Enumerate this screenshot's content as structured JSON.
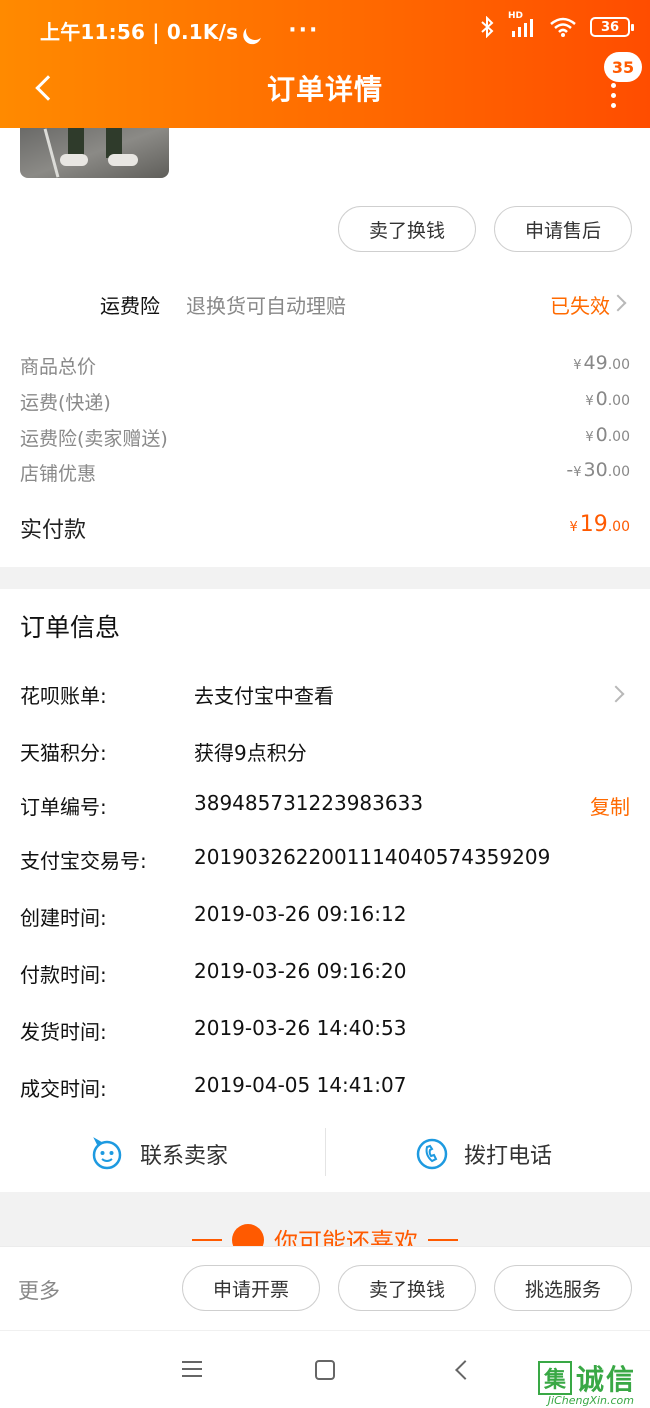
{
  "status_bar": {
    "time_speed": "上午11:56 | 0.1K/s",
    "more_dots": "···",
    "network": "HD",
    "battery": "36"
  },
  "nav": {
    "title": "订单详情",
    "badge_count": "35"
  },
  "order_actions": {
    "sell_exchange": "卖了换钱",
    "after_sale": "申请售后"
  },
  "insurance": {
    "label": "运费险",
    "description": "退换货可自动理赔",
    "status": "已失效"
  },
  "prices": [
    {
      "label": "商品总价",
      "currency": "¥",
      "integer": "49",
      "decimal": ".00",
      "prefix": ""
    },
    {
      "label": "运费(快递)",
      "currency": "¥",
      "integer": "0",
      "decimal": ".00",
      "prefix": ""
    },
    {
      "label": "运费险(卖家赠送)",
      "currency": "¥",
      "integer": "0",
      "decimal": ".00",
      "prefix": ""
    },
    {
      "label": "店铺优惠",
      "currency": "¥",
      "integer": "30",
      "decimal": ".00",
      "prefix": "-"
    }
  ],
  "total": {
    "label": "实付款",
    "currency": "¥",
    "integer": "19",
    "decimal": ".00"
  },
  "order_info": {
    "title": "订单信息",
    "rows": [
      {
        "label": "花呗账单:",
        "value": "去支付宝中查看"
      },
      {
        "label": "天猫积分:",
        "value": "获得9点积分"
      },
      {
        "label": "订单编号:",
        "value": "389485731223983633",
        "action": "复制"
      },
      {
        "label": "支付宝交易号:",
        "value": "2019032622001114040574359209"
      },
      {
        "label": "创建时间:",
        "value": "2019-03-26 09:16:12"
      },
      {
        "label": "付款时间:",
        "value": "2019-03-26 09:16:20"
      },
      {
        "label": "发货时间:",
        "value": "2019-03-26 14:40:53"
      },
      {
        "label": "成交时间:",
        "value": "2019-04-05 14:41:07"
      }
    ]
  },
  "contact": {
    "seller": "联系卖家",
    "phone": "拨打电话"
  },
  "recommend": {
    "title": "你可能还喜欢"
  },
  "bottom_bar": {
    "more": "更多",
    "invoice": "申请开票",
    "sell_exchange": "卖了换钱",
    "choose_service": "挑选服务"
  },
  "watermark": {
    "char": "集",
    "text": "诚信",
    "sub": "JiChengXin.com"
  },
  "colors": {
    "accent": "#ff6a00",
    "header_start": "#ff8a00",
    "header_end": "#ff4d00",
    "icon_blue": "#1e9ae0"
  }
}
